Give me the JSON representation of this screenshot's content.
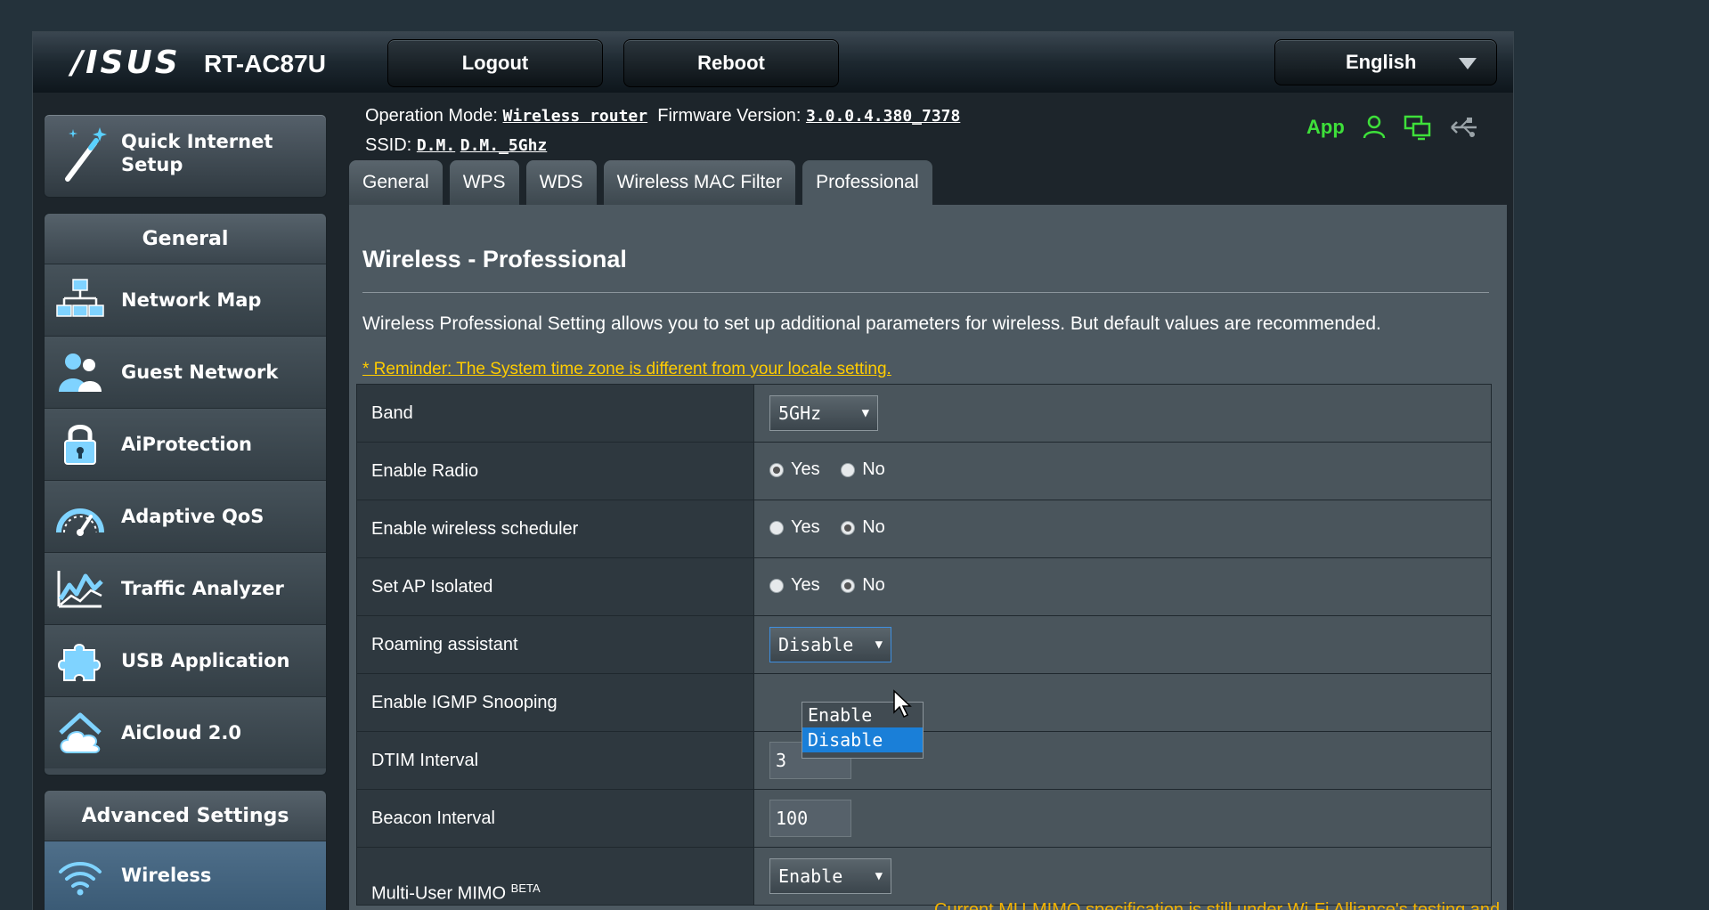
{
  "header": {
    "brand": "/ISUS",
    "model": "RT-AC87U",
    "logout_label": "Logout",
    "reboot_label": "Reboot",
    "language": "English"
  },
  "info": {
    "op_mode_label": "Operation Mode:",
    "op_mode_value": "Wireless router",
    "firmware_label": "Firmware Version:",
    "firmware_value": "3.0.0.4.380_7378",
    "ssid_label": "SSID:",
    "ssid_1": "D.M.",
    "ssid_2": "D.M._5Ghz",
    "app_label": "App"
  },
  "sidebar": {
    "quick_setup_line1": "Quick Internet",
    "quick_setup_line2": "Setup",
    "general_header": "General",
    "general_items": [
      {
        "label": "Network Map",
        "icon": "network-map-icon"
      },
      {
        "label": "Guest Network",
        "icon": "guest-network-icon"
      },
      {
        "label": "AiProtection",
        "icon": "lock-icon"
      },
      {
        "label": "Adaptive QoS",
        "icon": "gauge-icon"
      },
      {
        "label": "Traffic Analyzer",
        "icon": "traffic-chart-icon"
      },
      {
        "label": "USB Application",
        "icon": "puzzle-icon"
      },
      {
        "label": "AiCloud 2.0",
        "icon": "cloud-home-icon"
      }
    ],
    "advanced_header": "Advanced Settings",
    "advanced_items": [
      {
        "label": "Wireless",
        "icon": "wifi-icon"
      }
    ]
  },
  "tabs": [
    {
      "label": "General"
    },
    {
      "label": "WPS"
    },
    {
      "label": "WDS"
    },
    {
      "label": "Wireless MAC Filter"
    },
    {
      "label": "Professional",
      "active": true
    }
  ],
  "main": {
    "title": "Wireless - Professional",
    "description": "Wireless Professional Setting allows you to set up additional parameters for wireless. But default values are recommended.",
    "reminder": "* Reminder: The System time zone is different from your locale setting.",
    "yes_label": "Yes",
    "no_label": "No",
    "rows": {
      "band": {
        "label": "Band",
        "value": "5GHz"
      },
      "enable_radio": {
        "label": "Enable Radio",
        "selected": "Yes"
      },
      "scheduler": {
        "label": "Enable wireless scheduler",
        "selected": "No"
      },
      "ap_isolated": {
        "label": "Set AP Isolated",
        "selected": "No"
      },
      "roaming": {
        "label": "Roaming assistant",
        "value": "Disable",
        "options": [
          "Enable",
          "Disable"
        ]
      },
      "igmp": {
        "label": "Enable IGMP Snooping"
      },
      "dtim": {
        "label": "DTIM Interval",
        "value": "3"
      },
      "beacon": {
        "label": "Beacon Interval",
        "value": "100"
      },
      "mumimo": {
        "label": "Multi-User MIMO",
        "beta": "BETA",
        "value": "Enable"
      }
    },
    "mumimo_warning": "Current MU-MIMO specification is still under Wi-Fi Alliance's testing and might have compatibility issues among different brands. Wi-Fi"
  },
  "colors": {
    "app_green": "#3ee03a",
    "reminder_yellow": "#ffcc00",
    "warning_orange": "#f5b400",
    "dropdown_highlight": "#1a7fd8"
  }
}
